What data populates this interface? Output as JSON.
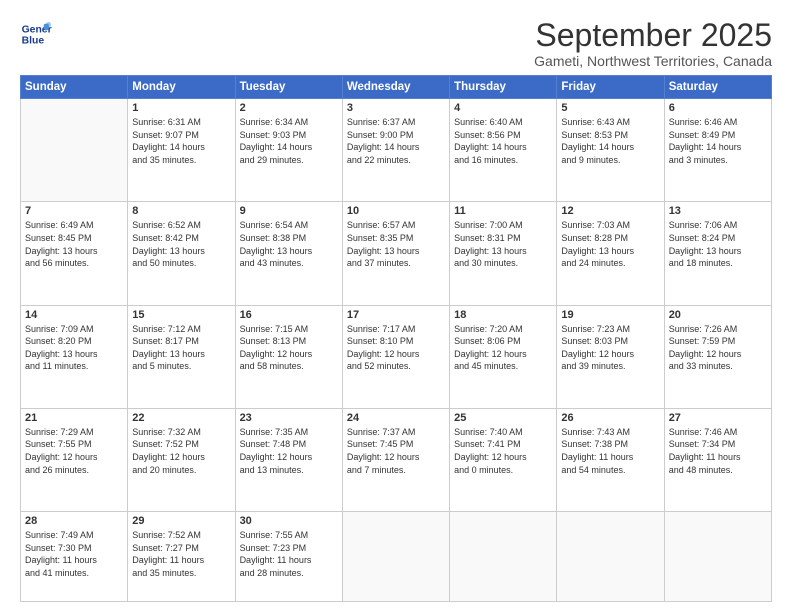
{
  "header": {
    "logo_line1": "General",
    "logo_line2": "Blue",
    "month": "September 2025",
    "location": "Gameti, Northwest Territories, Canada"
  },
  "weekdays": [
    "Sunday",
    "Monday",
    "Tuesday",
    "Wednesday",
    "Thursday",
    "Friday",
    "Saturday"
  ],
  "weeks": [
    [
      {
        "day": "",
        "info": ""
      },
      {
        "day": "1",
        "info": "Sunrise: 6:31 AM\nSunset: 9:07 PM\nDaylight: 14 hours\nand 35 minutes."
      },
      {
        "day": "2",
        "info": "Sunrise: 6:34 AM\nSunset: 9:03 PM\nDaylight: 14 hours\nand 29 minutes."
      },
      {
        "day": "3",
        "info": "Sunrise: 6:37 AM\nSunset: 9:00 PM\nDaylight: 14 hours\nand 22 minutes."
      },
      {
        "day": "4",
        "info": "Sunrise: 6:40 AM\nSunset: 8:56 PM\nDaylight: 14 hours\nand 16 minutes."
      },
      {
        "day": "5",
        "info": "Sunrise: 6:43 AM\nSunset: 8:53 PM\nDaylight: 14 hours\nand 9 minutes."
      },
      {
        "day": "6",
        "info": "Sunrise: 6:46 AM\nSunset: 8:49 PM\nDaylight: 14 hours\nand 3 minutes."
      }
    ],
    [
      {
        "day": "7",
        "info": "Sunrise: 6:49 AM\nSunset: 8:45 PM\nDaylight: 13 hours\nand 56 minutes."
      },
      {
        "day": "8",
        "info": "Sunrise: 6:52 AM\nSunset: 8:42 PM\nDaylight: 13 hours\nand 50 minutes."
      },
      {
        "day": "9",
        "info": "Sunrise: 6:54 AM\nSunset: 8:38 PM\nDaylight: 13 hours\nand 43 minutes."
      },
      {
        "day": "10",
        "info": "Sunrise: 6:57 AM\nSunset: 8:35 PM\nDaylight: 13 hours\nand 37 minutes."
      },
      {
        "day": "11",
        "info": "Sunrise: 7:00 AM\nSunset: 8:31 PM\nDaylight: 13 hours\nand 30 minutes."
      },
      {
        "day": "12",
        "info": "Sunrise: 7:03 AM\nSunset: 8:28 PM\nDaylight: 13 hours\nand 24 minutes."
      },
      {
        "day": "13",
        "info": "Sunrise: 7:06 AM\nSunset: 8:24 PM\nDaylight: 13 hours\nand 18 minutes."
      }
    ],
    [
      {
        "day": "14",
        "info": "Sunrise: 7:09 AM\nSunset: 8:20 PM\nDaylight: 13 hours\nand 11 minutes."
      },
      {
        "day": "15",
        "info": "Sunrise: 7:12 AM\nSunset: 8:17 PM\nDaylight: 13 hours\nand 5 minutes."
      },
      {
        "day": "16",
        "info": "Sunrise: 7:15 AM\nSunset: 8:13 PM\nDaylight: 12 hours\nand 58 minutes."
      },
      {
        "day": "17",
        "info": "Sunrise: 7:17 AM\nSunset: 8:10 PM\nDaylight: 12 hours\nand 52 minutes."
      },
      {
        "day": "18",
        "info": "Sunrise: 7:20 AM\nSunset: 8:06 PM\nDaylight: 12 hours\nand 45 minutes."
      },
      {
        "day": "19",
        "info": "Sunrise: 7:23 AM\nSunset: 8:03 PM\nDaylight: 12 hours\nand 39 minutes."
      },
      {
        "day": "20",
        "info": "Sunrise: 7:26 AM\nSunset: 7:59 PM\nDaylight: 12 hours\nand 33 minutes."
      }
    ],
    [
      {
        "day": "21",
        "info": "Sunrise: 7:29 AM\nSunset: 7:55 PM\nDaylight: 12 hours\nand 26 minutes."
      },
      {
        "day": "22",
        "info": "Sunrise: 7:32 AM\nSunset: 7:52 PM\nDaylight: 12 hours\nand 20 minutes."
      },
      {
        "day": "23",
        "info": "Sunrise: 7:35 AM\nSunset: 7:48 PM\nDaylight: 12 hours\nand 13 minutes."
      },
      {
        "day": "24",
        "info": "Sunrise: 7:37 AM\nSunset: 7:45 PM\nDaylight: 12 hours\nand 7 minutes."
      },
      {
        "day": "25",
        "info": "Sunrise: 7:40 AM\nSunset: 7:41 PM\nDaylight: 12 hours\nand 0 minutes."
      },
      {
        "day": "26",
        "info": "Sunrise: 7:43 AM\nSunset: 7:38 PM\nDaylight: 11 hours\nand 54 minutes."
      },
      {
        "day": "27",
        "info": "Sunrise: 7:46 AM\nSunset: 7:34 PM\nDaylight: 11 hours\nand 48 minutes."
      }
    ],
    [
      {
        "day": "28",
        "info": "Sunrise: 7:49 AM\nSunset: 7:30 PM\nDaylight: 11 hours\nand 41 minutes."
      },
      {
        "day": "29",
        "info": "Sunrise: 7:52 AM\nSunset: 7:27 PM\nDaylight: 11 hours\nand 35 minutes."
      },
      {
        "day": "30",
        "info": "Sunrise: 7:55 AM\nSunset: 7:23 PM\nDaylight: 11 hours\nand 28 minutes."
      },
      {
        "day": "",
        "info": ""
      },
      {
        "day": "",
        "info": ""
      },
      {
        "day": "",
        "info": ""
      },
      {
        "day": "",
        "info": ""
      }
    ]
  ]
}
